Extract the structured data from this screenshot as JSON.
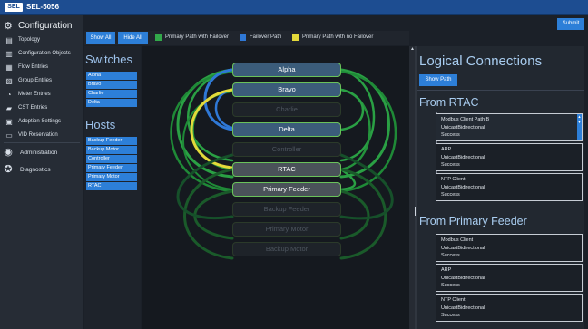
{
  "header": {
    "logo": "SEL",
    "model": "SEL-5056"
  },
  "nav": {
    "title": "Configuration",
    "items": [
      {
        "label": "Topology",
        "icon": "sitemap-icon",
        "glyph": "▤"
      },
      {
        "label": "Configuration Objects",
        "icon": "bar-chart-icon",
        "glyph": "▥"
      },
      {
        "label": "Flow Entries",
        "icon": "flow-grid-icon",
        "glyph": "▦"
      },
      {
        "label": "Group Entries",
        "icon": "group-icon",
        "glyph": "▧"
      },
      {
        "label": "Meter Entries",
        "icon": "meter-icon",
        "glyph": "◔"
      },
      {
        "label": "CST Entries",
        "icon": "cst-icon",
        "glyph": "▰"
      },
      {
        "label": "Adoption Settings",
        "icon": "adoption-icon",
        "glyph": "▣"
      },
      {
        "label": "VID Reservation",
        "icon": "vid-icon",
        "glyph": "▭"
      },
      {
        "label": "Administration",
        "icon": "user-icon",
        "glyph": "◉"
      },
      {
        "label": "Diagnostics",
        "icon": "diagnostics-icon",
        "glyph": "✪"
      }
    ],
    "more": "···"
  },
  "submit_label": "Submit",
  "toolbar": {
    "show_all": "Show All",
    "hide_all": "Hide All",
    "legend": [
      {
        "label": "Primary Path with Failover",
        "color": "#32a84a"
      },
      {
        "label": "Failover Path",
        "color": "#2f78d6"
      },
      {
        "label": "Primary Path with no Failover",
        "color": "#e3d93a"
      }
    ]
  },
  "switches": {
    "title": "Switches",
    "items": [
      "Alpha",
      "Bravo",
      "Charlie",
      "Delta"
    ]
  },
  "hosts": {
    "title": "Hosts",
    "items": [
      "Backup Feeder",
      "Backup Motor",
      "Controller",
      "Primary Feeder",
      "Primary Motor",
      "RTAC"
    ]
  },
  "diagram": {
    "nodes": [
      {
        "label": "Alpha",
        "state": "active"
      },
      {
        "label": "Bravo",
        "state": "active"
      },
      {
        "label": "Charlie",
        "state": "dim"
      },
      {
        "label": "Delta",
        "state": "active"
      },
      {
        "label": "Controller",
        "state": "dim"
      },
      {
        "label": "RTAC",
        "state": "sel"
      },
      {
        "label": "Primary Feeder",
        "state": "sel"
      },
      {
        "label": "Backup Feeder",
        "state": "dim"
      },
      {
        "label": "Primary Motor",
        "state": "dim"
      },
      {
        "label": "Backup Motor",
        "state": "dim"
      }
    ],
    "colors": {
      "green": "#2fa84a",
      "blue": "#2f78d6",
      "yellow": "#e3d93a"
    }
  },
  "logical": {
    "title": "Logical Connections",
    "show_path": "Show Path",
    "sections": [
      {
        "title": "From RTAC",
        "cards": [
          [
            "Modbus Client Path B",
            "UnicastBidirectional",
            "Success"
          ],
          [
            "ARP",
            "UnicastBidirectional",
            "Success"
          ],
          [
            "NTP Client",
            "UnicastBidirectional",
            "Success"
          ]
        ]
      },
      {
        "title": "From Primary Feeder",
        "cards": [
          [
            "Modbus Client",
            "UnicastBidirectional",
            "Success"
          ],
          [
            "ARP",
            "UnicastBidirectional",
            "Success"
          ],
          [
            "NTP Client",
            "UnicastBidirectional",
            "Success"
          ]
        ]
      }
    ]
  }
}
